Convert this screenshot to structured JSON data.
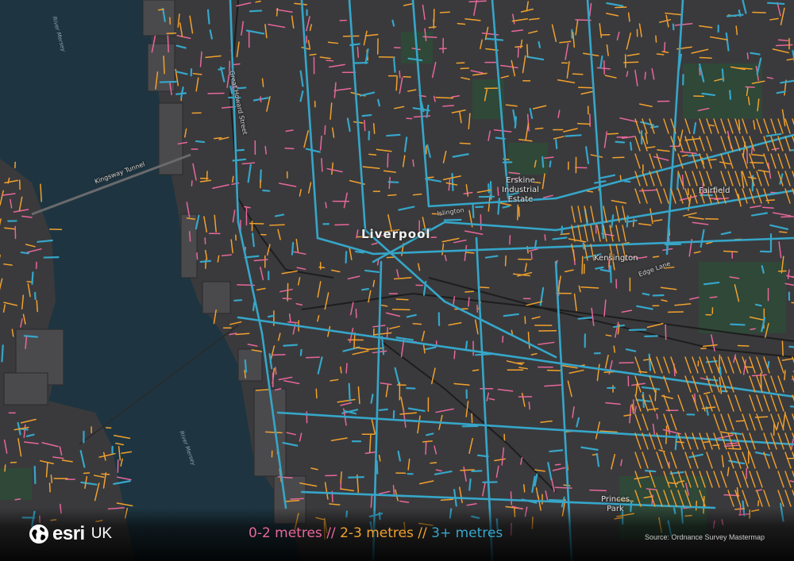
{
  "colors": {
    "background": "#3a3a3c",
    "water": "#1e3541",
    "green_space": "#2f4838",
    "dock": "#4a4a4c",
    "road_narrow": "#e8679b",
    "road_medium": "#f2a12c",
    "road_wide": "#36a6c9",
    "rail": "#1d1d1d"
  },
  "map": {
    "city_label": "Liverpool",
    "place_labels": {
      "erskine_line1": "Erskine",
      "erskine_line2": "Industrial",
      "erskine_line3": "Estate",
      "fairfield": "Fairfield",
      "kensington": "Kensington",
      "princes_park_line1": "Princes",
      "princes_park_line2": "Park"
    },
    "road_labels": {
      "kingsway_tunnel": "Kingsway Tunnel",
      "great_howard_street": "Great Howard Street",
      "islington": "Islington",
      "edge_lane": "Edge Lane"
    },
    "water_labels": {
      "river_mersey_north": "River Mersey",
      "river_mersey_south": "River Mersey"
    }
  },
  "footer": {
    "logo_text": "esri",
    "logo_sub": "UK",
    "logo_icon": "globe-icon",
    "legend": {
      "narrow": "0-2 metres",
      "sep1": " // ",
      "medium": "2-3 metres",
      "sep2": " // ",
      "wide": "3+ metres"
    },
    "source": "Source: Ordnance Survey Mastermap"
  }
}
